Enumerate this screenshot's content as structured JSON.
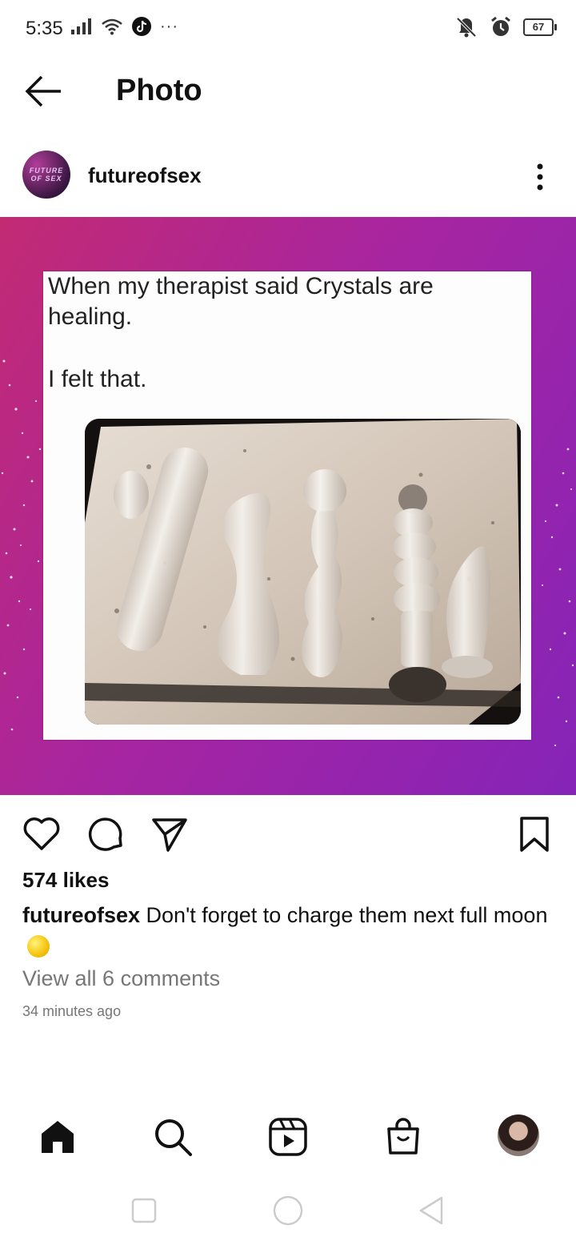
{
  "status_bar": {
    "time": "5:35",
    "battery": "67",
    "icons": [
      "signal-icon",
      "wifi-icon",
      "tiktok-icon",
      "more-dots-icon",
      "mute-icon",
      "alarm-icon",
      "battery-icon"
    ]
  },
  "header": {
    "title": "Photo",
    "back_icon": "back-arrow-icon"
  },
  "post": {
    "username": "futureofsex",
    "avatar_text": "FUTURE OF SEX",
    "meme": {
      "line1": "When my therapist said Crystals are",
      "line2": "healing.",
      "line3": "I felt that."
    },
    "likes": "574 likes",
    "caption_user": "futureofsex",
    "caption_text": " Don't forget to charge them next full moon",
    "view_comments": "View all 6 comments",
    "time_ago": "34 minutes ago"
  },
  "actions": [
    "heart-icon",
    "comment-icon",
    "share-icon",
    "bookmark-icon"
  ],
  "bottom_nav": [
    "home-icon",
    "search-icon",
    "reels-icon",
    "shop-icon",
    "profile-avatar"
  ],
  "colors": {
    "gradient_start": "#c22a73",
    "gradient_end": "#8524b8",
    "muted_text": "#777777"
  }
}
